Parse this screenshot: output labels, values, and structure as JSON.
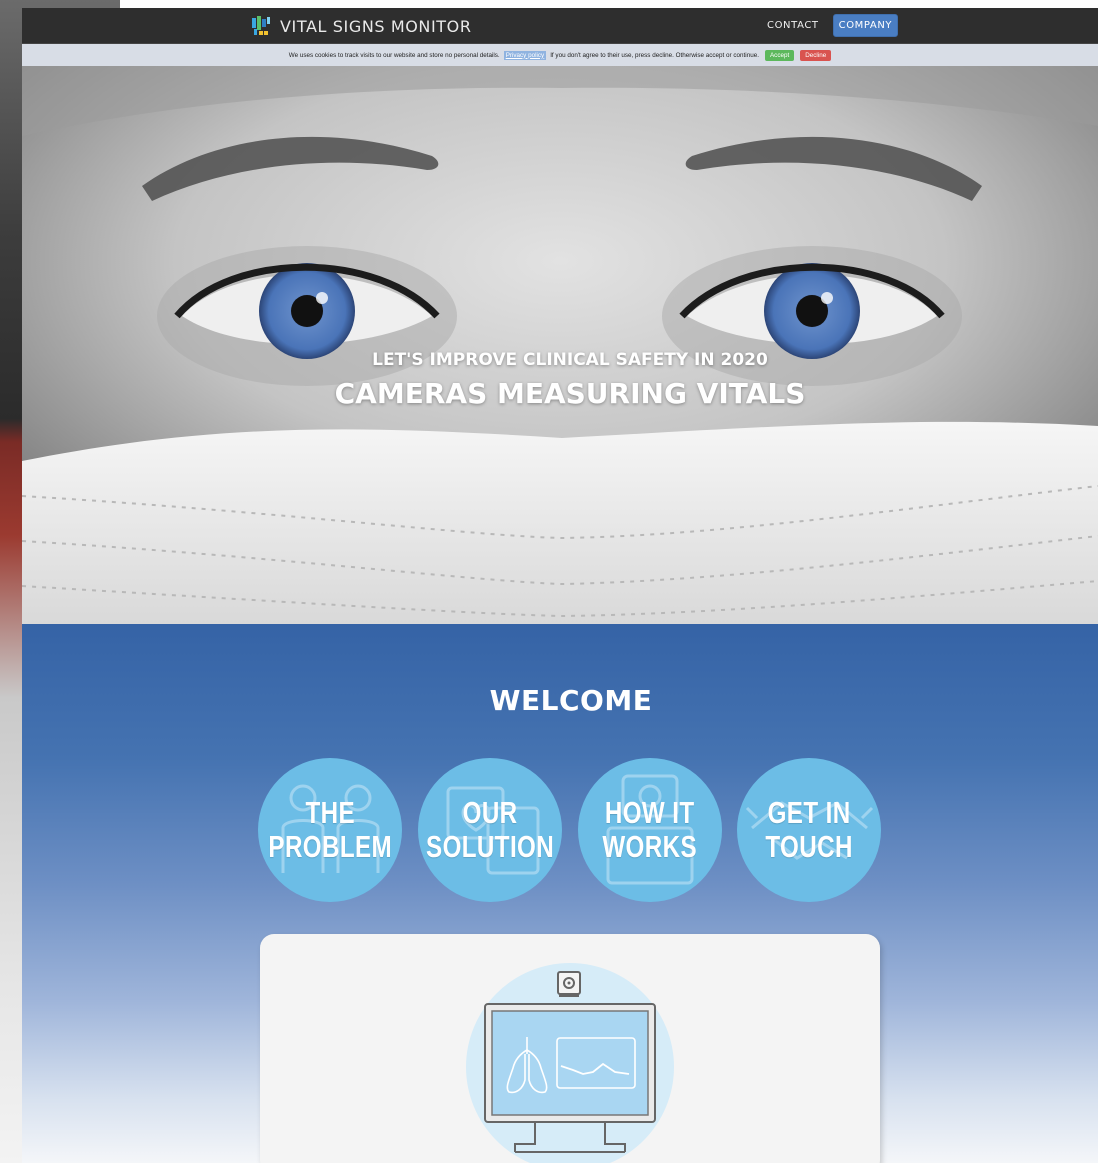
{
  "navbar": {
    "brand": "VITAL SIGNS MONITOR",
    "links": [
      {
        "label": "CONTACT",
        "active": false
      },
      {
        "label": "COMPANY",
        "active": true
      }
    ]
  },
  "cookie_bar": {
    "text_before": "We uses cookies to track visits to our website and store no personal details.",
    "privacy_link": "Privacy policy",
    "text_after": "If you don't agree to their use, press decline. Otherwise accept or continue.",
    "accept_label": "Accept",
    "decline_label": "Decline",
    "accept_color": "#5cb85c",
    "decline_color": "#d9534f"
  },
  "hero": {
    "subtitle": "LET'S IMPROVE CLINICAL SAFETY IN 2020",
    "title": "CAMERAS MEASURING VITALS"
  },
  "welcome": {
    "title": "WELCOME",
    "circles": [
      {
        "line1": "THE",
        "line2": "PROBLEM",
        "icon": "patients-icon"
      },
      {
        "line1": "OUR",
        "line2": "SOLUTION",
        "icon": "monitor-heart-icon"
      },
      {
        "line1": "HOW IT",
        "line2": "WORKS",
        "icon": "camera-icon"
      },
      {
        "line1": "GET IN",
        "line2": "TOUCH",
        "icon": "handshake-icon"
      }
    ],
    "card_icon": "camera-monitor-lungs-icon"
  },
  "colors": {
    "navbar_bg": "#2e2e2e",
    "accent_blue": "#4a7ec3",
    "circle_blue": "#6cbde6",
    "section_blue": "#3563a6"
  }
}
